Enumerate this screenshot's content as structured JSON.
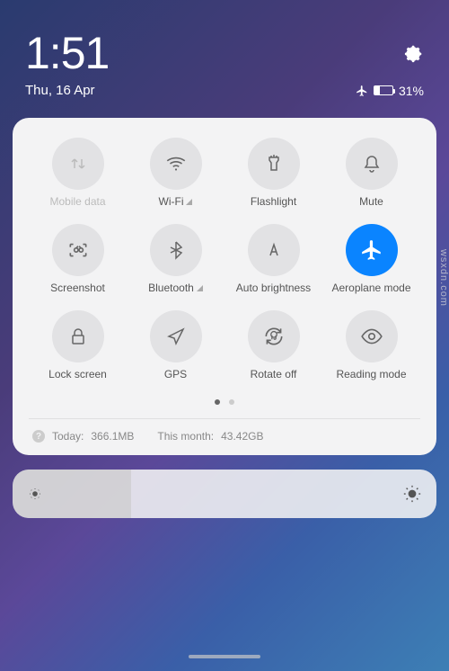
{
  "status": {
    "time": "1:51",
    "date": "Thu, 16 Apr",
    "battery_percent": "31%"
  },
  "tiles": {
    "mobile_data": "Mobile data",
    "wifi": "Wi-Fi",
    "flashlight": "Flashlight",
    "mute": "Mute",
    "screenshot": "Screenshot",
    "bluetooth": "Bluetooth",
    "auto_brightness": "Auto brightness",
    "aeroplane": "Aeroplane mode",
    "lock_screen": "Lock screen",
    "gps": "GPS",
    "rotate_off": "Rotate off",
    "reading_mode": "Reading mode"
  },
  "usage": {
    "today_label": "Today:",
    "today_value": "366.1MB",
    "month_label": "This month:",
    "month_value": "43.42GB"
  },
  "watermark": "wsxdn.com"
}
